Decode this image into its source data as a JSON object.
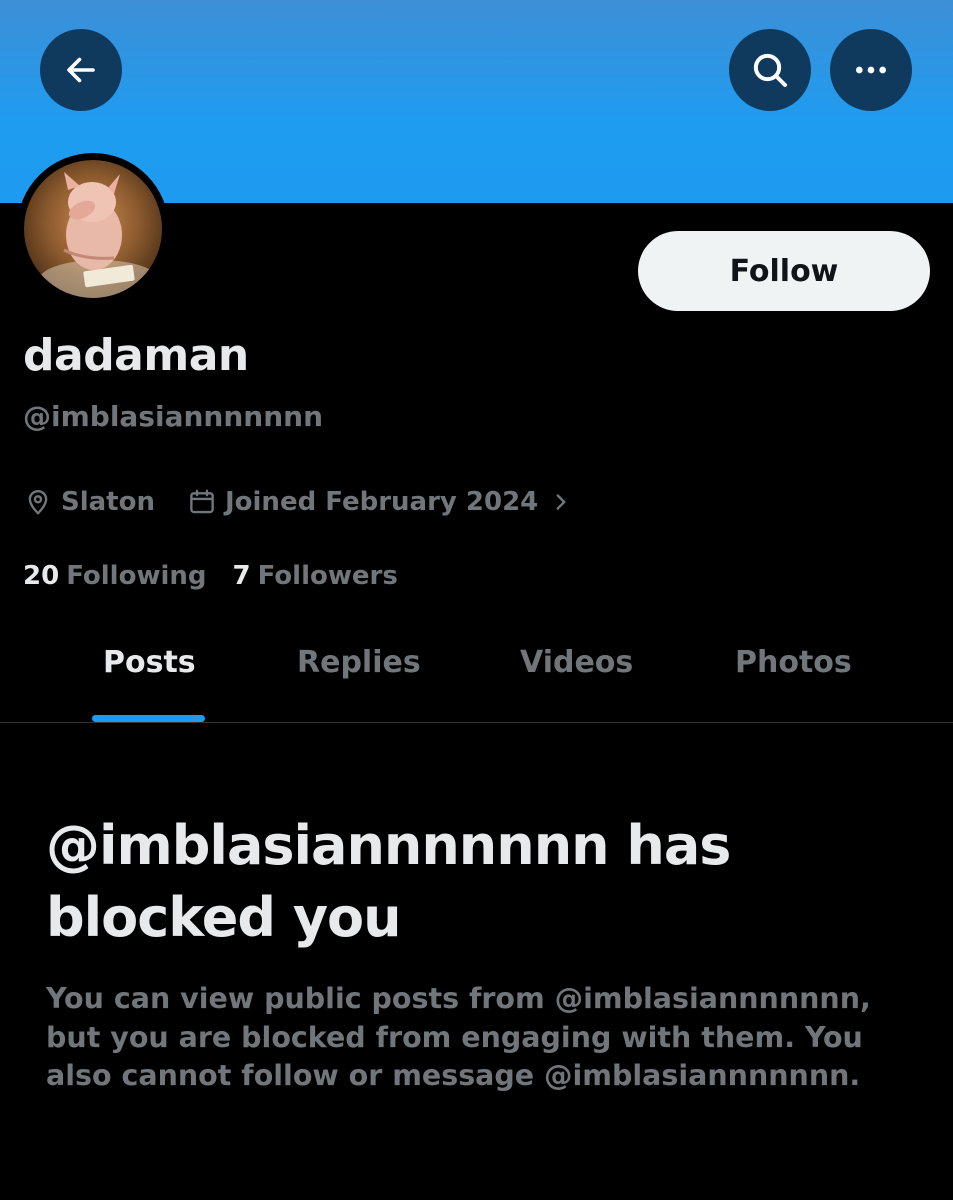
{
  "profile": {
    "display_name": "dadaman",
    "handle": "@imblasiannnnnnn",
    "location": "Slaton",
    "joined": "Joined February 2024",
    "following_count": "20",
    "following_label": "Following",
    "followers_count": "7",
    "followers_label": "Followers"
  },
  "actions": {
    "follow_label": "Follow"
  },
  "tabs": [
    {
      "label": "Posts",
      "active": true
    },
    {
      "label": "Replies",
      "active": false
    },
    {
      "label": "Videos",
      "active": false
    },
    {
      "label": "Photos",
      "active": false
    }
  ],
  "blocked": {
    "title": "@imblasiannnnnnn has blocked you",
    "body": "You can view public posts from @imblasiannnnnnn, but you are blocked from engaging with them. You also cannot follow or message @imblasiannnnnnn."
  },
  "icons": {
    "back": "arrow-left-icon",
    "search": "search-icon",
    "more": "more-horizontal-icon",
    "location": "location-pin-icon",
    "calendar": "calendar-icon",
    "chevron": "chevron-right-icon"
  },
  "colors": {
    "accent": "#1d9bf0",
    "background": "#000000",
    "primary_text": "#e7e9ea",
    "secondary_text": "#71767b",
    "banner": "#1d9bf0"
  }
}
